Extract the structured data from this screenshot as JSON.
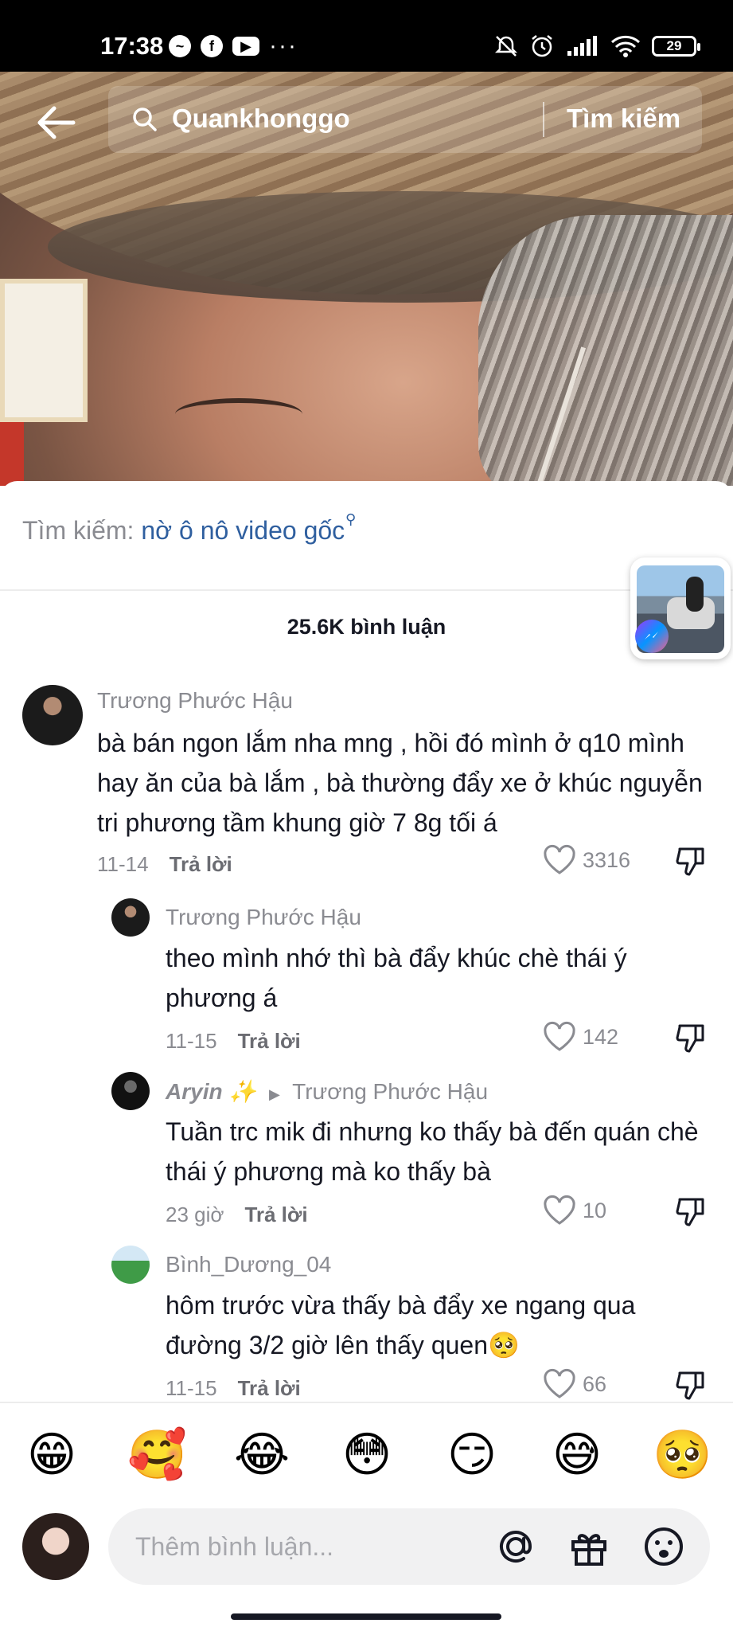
{
  "status_bar": {
    "time": "17:38",
    "battery": "29"
  },
  "search_bar": {
    "query": "Quankhonggo",
    "button_label": "Tìm kiếm"
  },
  "panel": {
    "suggestion_label": "Tìm kiếm: ",
    "suggestion_query": "nờ ô nô video gốc",
    "comment_count": "25.6K bình luận"
  },
  "comments": [
    {
      "username": "Trương Phước Hậu",
      "text": "bà bán ngon lắm nha mng , hồi đó mình ở q10 mình hay ăn của bà lắm , bà thường đẩy xe ở khúc nguyễn tri phương tầm khung giờ 7 8g tối á",
      "date": "11-14",
      "reply_label": "Trả lời",
      "likes": "3316"
    },
    {
      "username": "Trương Phước Hậu",
      "text": "theo mình nhớ thì bà đẩy khúc chè thái ý phương á",
      "date": "11-15",
      "reply_label": "Trả lời",
      "likes": "142"
    },
    {
      "username": "Aryin ✨",
      "reply_to": "Trương Phước Hậu",
      "text": "Tuần trc mik đi nhưng ko thấy bà đến quán chè thái ý phương mà ko thấy bà",
      "date": "23 giờ",
      "reply_label": "Trả lời",
      "likes": "10"
    },
    {
      "username": "Bình_Dương_04",
      "text": "hôm trước vừa thấy bà đẩy xe ngang qua đường 3/2 giờ lên thấy quen🥺",
      "date": "11-15",
      "reply_label": "Trả lời",
      "likes": "66"
    }
  ],
  "emojis": [
    "😁",
    "🥰",
    "😂",
    "😳",
    "😏",
    "😅",
    "🥺"
  ],
  "input": {
    "placeholder": "Thêm bình luận..."
  },
  "colors": {
    "link": "#2f5f9f",
    "secondary_text": "#8a8b91",
    "primary_text": "#161823"
  }
}
